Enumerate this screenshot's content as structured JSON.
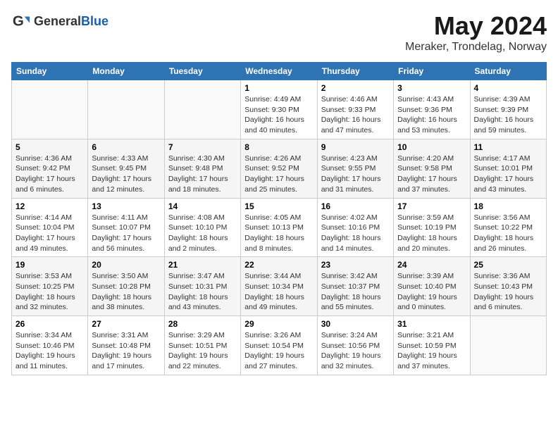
{
  "header": {
    "logo_general": "General",
    "logo_blue": "Blue",
    "title": "May 2024",
    "location": "Meraker, Trondelag, Norway"
  },
  "weekdays": [
    "Sunday",
    "Monday",
    "Tuesday",
    "Wednesday",
    "Thursday",
    "Friday",
    "Saturday"
  ],
  "weeks": [
    [
      {
        "day": "",
        "info": ""
      },
      {
        "day": "",
        "info": ""
      },
      {
        "day": "",
        "info": ""
      },
      {
        "day": "1",
        "info": "Sunrise: 4:49 AM\nSunset: 9:30 PM\nDaylight: 16 hours\nand 40 minutes."
      },
      {
        "day": "2",
        "info": "Sunrise: 4:46 AM\nSunset: 9:33 PM\nDaylight: 16 hours\nand 47 minutes."
      },
      {
        "day": "3",
        "info": "Sunrise: 4:43 AM\nSunset: 9:36 PM\nDaylight: 16 hours\nand 53 minutes."
      },
      {
        "day": "4",
        "info": "Sunrise: 4:39 AM\nSunset: 9:39 PM\nDaylight: 16 hours\nand 59 minutes."
      }
    ],
    [
      {
        "day": "5",
        "info": "Sunrise: 4:36 AM\nSunset: 9:42 PM\nDaylight: 17 hours\nand 6 minutes."
      },
      {
        "day": "6",
        "info": "Sunrise: 4:33 AM\nSunset: 9:45 PM\nDaylight: 17 hours\nand 12 minutes."
      },
      {
        "day": "7",
        "info": "Sunrise: 4:30 AM\nSunset: 9:48 PM\nDaylight: 17 hours\nand 18 minutes."
      },
      {
        "day": "8",
        "info": "Sunrise: 4:26 AM\nSunset: 9:52 PM\nDaylight: 17 hours\nand 25 minutes."
      },
      {
        "day": "9",
        "info": "Sunrise: 4:23 AM\nSunset: 9:55 PM\nDaylight: 17 hours\nand 31 minutes."
      },
      {
        "day": "10",
        "info": "Sunrise: 4:20 AM\nSunset: 9:58 PM\nDaylight: 17 hours\nand 37 minutes."
      },
      {
        "day": "11",
        "info": "Sunrise: 4:17 AM\nSunset: 10:01 PM\nDaylight: 17 hours\nand 43 minutes."
      }
    ],
    [
      {
        "day": "12",
        "info": "Sunrise: 4:14 AM\nSunset: 10:04 PM\nDaylight: 17 hours\nand 49 minutes."
      },
      {
        "day": "13",
        "info": "Sunrise: 4:11 AM\nSunset: 10:07 PM\nDaylight: 17 hours\nand 56 minutes."
      },
      {
        "day": "14",
        "info": "Sunrise: 4:08 AM\nSunset: 10:10 PM\nDaylight: 18 hours\nand 2 minutes."
      },
      {
        "day": "15",
        "info": "Sunrise: 4:05 AM\nSunset: 10:13 PM\nDaylight: 18 hours\nand 8 minutes."
      },
      {
        "day": "16",
        "info": "Sunrise: 4:02 AM\nSunset: 10:16 PM\nDaylight: 18 hours\nand 14 minutes."
      },
      {
        "day": "17",
        "info": "Sunrise: 3:59 AM\nSunset: 10:19 PM\nDaylight: 18 hours\nand 20 minutes."
      },
      {
        "day": "18",
        "info": "Sunrise: 3:56 AM\nSunset: 10:22 PM\nDaylight: 18 hours\nand 26 minutes."
      }
    ],
    [
      {
        "day": "19",
        "info": "Sunrise: 3:53 AM\nSunset: 10:25 PM\nDaylight: 18 hours\nand 32 minutes."
      },
      {
        "day": "20",
        "info": "Sunrise: 3:50 AM\nSunset: 10:28 PM\nDaylight: 18 hours\nand 38 minutes."
      },
      {
        "day": "21",
        "info": "Sunrise: 3:47 AM\nSunset: 10:31 PM\nDaylight: 18 hours\nand 43 minutes."
      },
      {
        "day": "22",
        "info": "Sunrise: 3:44 AM\nSunset: 10:34 PM\nDaylight: 18 hours\nand 49 minutes."
      },
      {
        "day": "23",
        "info": "Sunrise: 3:42 AM\nSunset: 10:37 PM\nDaylight: 18 hours\nand 55 minutes."
      },
      {
        "day": "24",
        "info": "Sunrise: 3:39 AM\nSunset: 10:40 PM\nDaylight: 19 hours\nand 0 minutes."
      },
      {
        "day": "25",
        "info": "Sunrise: 3:36 AM\nSunset: 10:43 PM\nDaylight: 19 hours\nand 6 minutes."
      }
    ],
    [
      {
        "day": "26",
        "info": "Sunrise: 3:34 AM\nSunset: 10:46 PM\nDaylight: 19 hours\nand 11 minutes."
      },
      {
        "day": "27",
        "info": "Sunrise: 3:31 AM\nSunset: 10:48 PM\nDaylight: 19 hours\nand 17 minutes."
      },
      {
        "day": "28",
        "info": "Sunrise: 3:29 AM\nSunset: 10:51 PM\nDaylight: 19 hours\nand 22 minutes."
      },
      {
        "day": "29",
        "info": "Sunrise: 3:26 AM\nSunset: 10:54 PM\nDaylight: 19 hours\nand 27 minutes."
      },
      {
        "day": "30",
        "info": "Sunrise: 3:24 AM\nSunset: 10:56 PM\nDaylight: 19 hours\nand 32 minutes."
      },
      {
        "day": "31",
        "info": "Sunrise: 3:21 AM\nSunset: 10:59 PM\nDaylight: 19 hours\nand 37 minutes."
      },
      {
        "day": "",
        "info": ""
      }
    ]
  ]
}
